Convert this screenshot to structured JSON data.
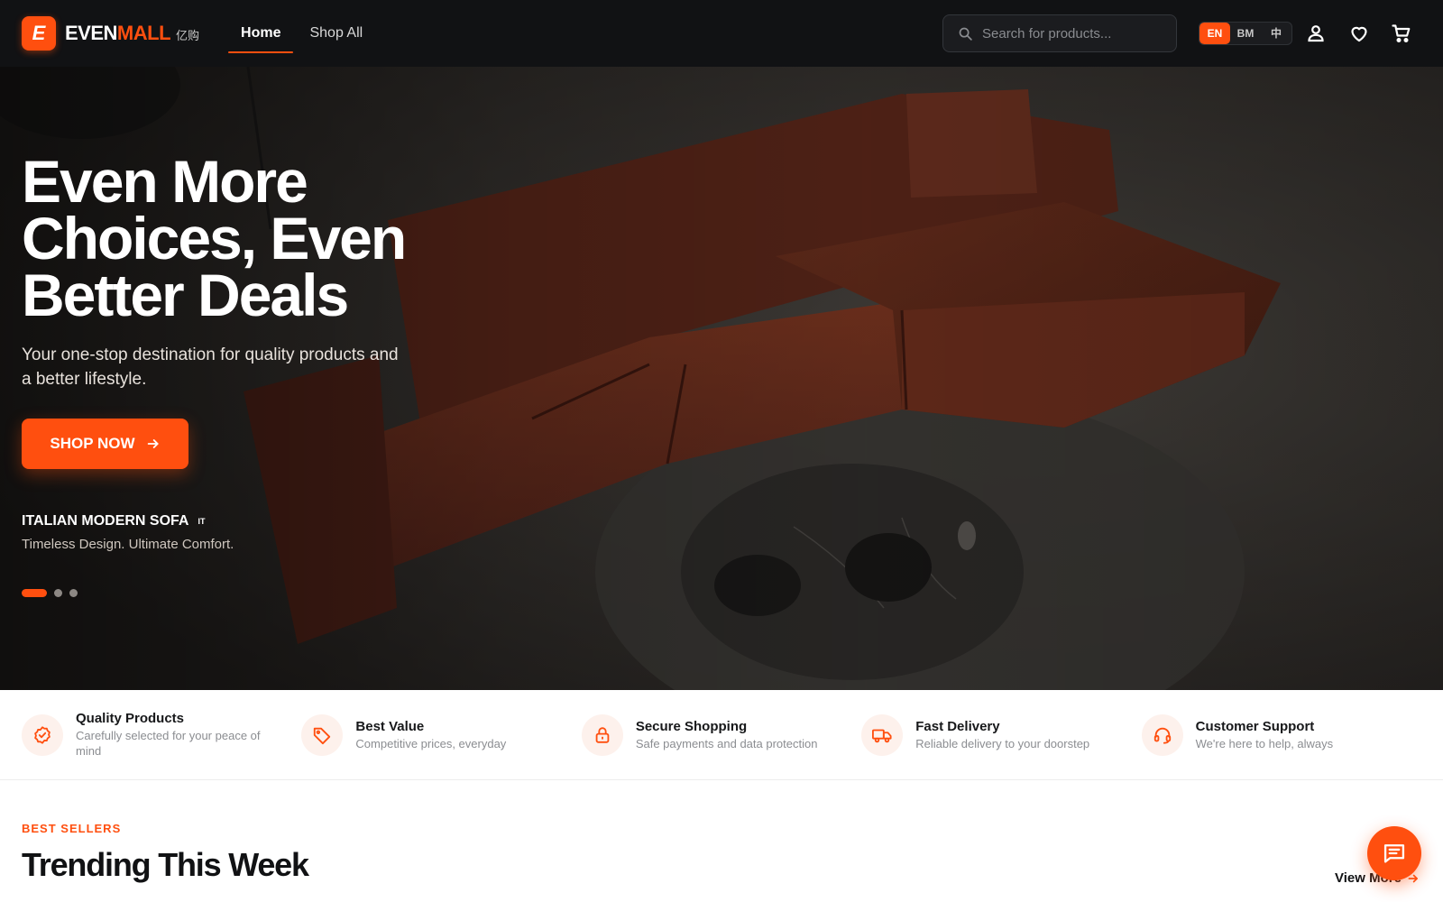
{
  "colors": {
    "accent": "#ff4f0f",
    "header_bg": "#111214"
  },
  "brand": {
    "badge": "E",
    "name_part1": "EVEN",
    "name_part2": "MALL",
    "name_cn": "亿购"
  },
  "nav": [
    {
      "label": "Home",
      "active": true
    },
    {
      "label": "Shop All",
      "active": false
    }
  ],
  "search": {
    "placeholder": "Search for products...",
    "value": "",
    "icon": "search-icon"
  },
  "languages": [
    {
      "label": "EN",
      "active": true
    },
    {
      "label": "BM",
      "active": false
    },
    {
      "label": "中",
      "active": false
    }
  ],
  "header_icons": [
    "user-icon",
    "heart-icon",
    "cart-icon"
  ],
  "hero": {
    "title": "Even More Choices, Even Better Deals",
    "subtitle": "Your one-stop destination for quality products and a better lifestyle.",
    "cta_label": "SHOP NOW",
    "product_name": "ITALIAN MODERN SOFA",
    "product_flag": "IT",
    "product_tagline": "Timeless Design. Ultimate Comfort.",
    "slides_total": 3,
    "slide_active": 1
  },
  "features": [
    {
      "icon": "badge-check-icon",
      "title": "Quality Products",
      "desc": "Carefully selected for your peace of mind"
    },
    {
      "icon": "tag-icon",
      "title": "Best Value",
      "desc": "Competitive prices, everyday"
    },
    {
      "icon": "lock-icon",
      "title": "Secure Shopping",
      "desc": "Safe payments and data protection"
    },
    {
      "icon": "truck-icon",
      "title": "Fast Delivery",
      "desc": "Reliable delivery to your doorstep"
    },
    {
      "icon": "headset-icon",
      "title": "Customer Support",
      "desc": "We're here to help, always"
    }
  ],
  "trending": {
    "eyebrow": "BEST SELLERS",
    "title": "Trending This Week",
    "view_more": "View More"
  },
  "chat": {
    "icon": "chat-icon"
  }
}
